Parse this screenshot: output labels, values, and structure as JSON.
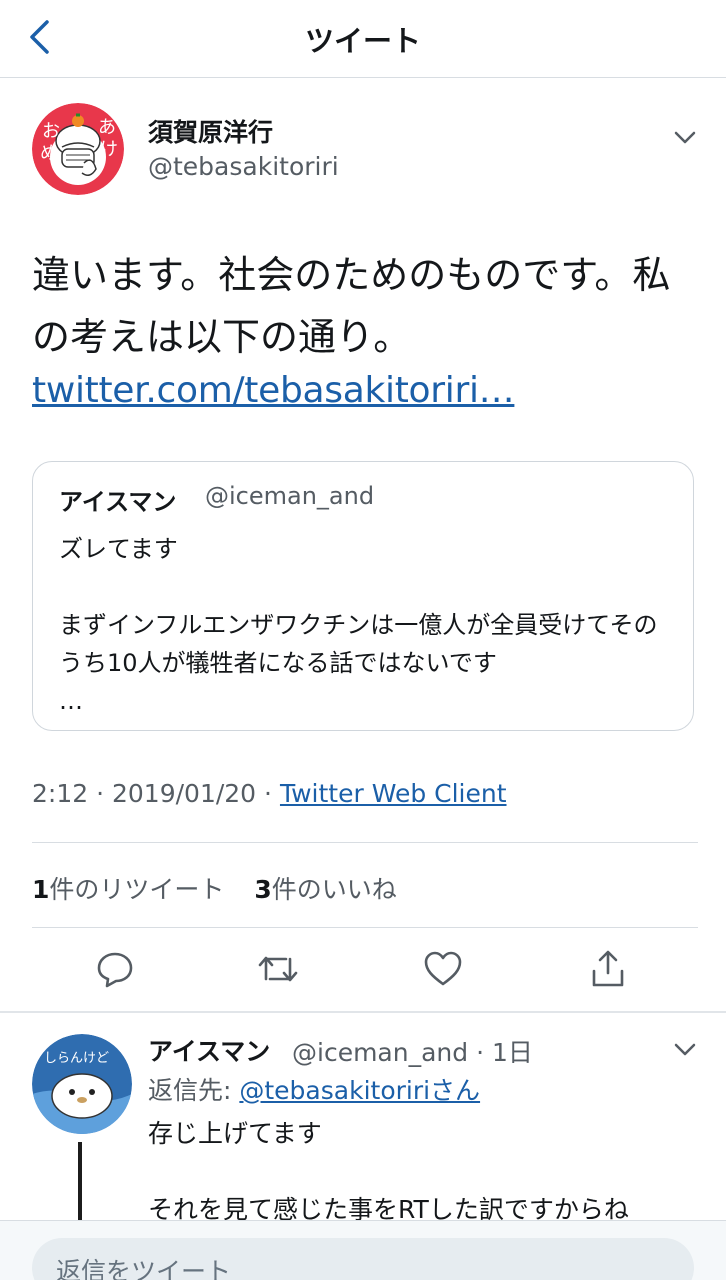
{
  "header": {
    "title": "ツイート"
  },
  "tweet": {
    "author_name": "須賀原洋行",
    "author_handle": "@tebasakitoriri",
    "avatar_text": [
      "お",
      "め",
      "あ",
      "け"
    ],
    "text": "違います。社会のためのものです。私の考えは以下の通り。",
    "link": "twitter.com/tebasakitoriri…",
    "quote": {
      "name": "アイスマン",
      "handle": "@iceman_and",
      "text": "ズレてます\n\nまずインフルエンザワクチンは一億人が全員受けてそのうち10人が犠牲者になる話ではないです\n…"
    },
    "time": "2:12",
    "date": "2019/01/20",
    "client": "Twitter Web Client",
    "retweet_count": "1",
    "retweet_label": "件のリツイート",
    "like_count": "3",
    "like_label": "件のいいね"
  },
  "reply": {
    "name": "アイスマン",
    "handle": "@iceman_and",
    "time": "1日",
    "reply_to_label": "返信先: ",
    "reply_to_link": "@tebasakitoririさん",
    "text": "存じ上げてます\n\nそれを見て感じた事をRTした訳ですからね",
    "avatar_text": "しらんけど"
  },
  "compose": {
    "placeholder": "返信をツイート"
  },
  "colors": {
    "link": "#1b5fa8",
    "secondary": "#555c63",
    "avatar_red": "#e8374b"
  }
}
